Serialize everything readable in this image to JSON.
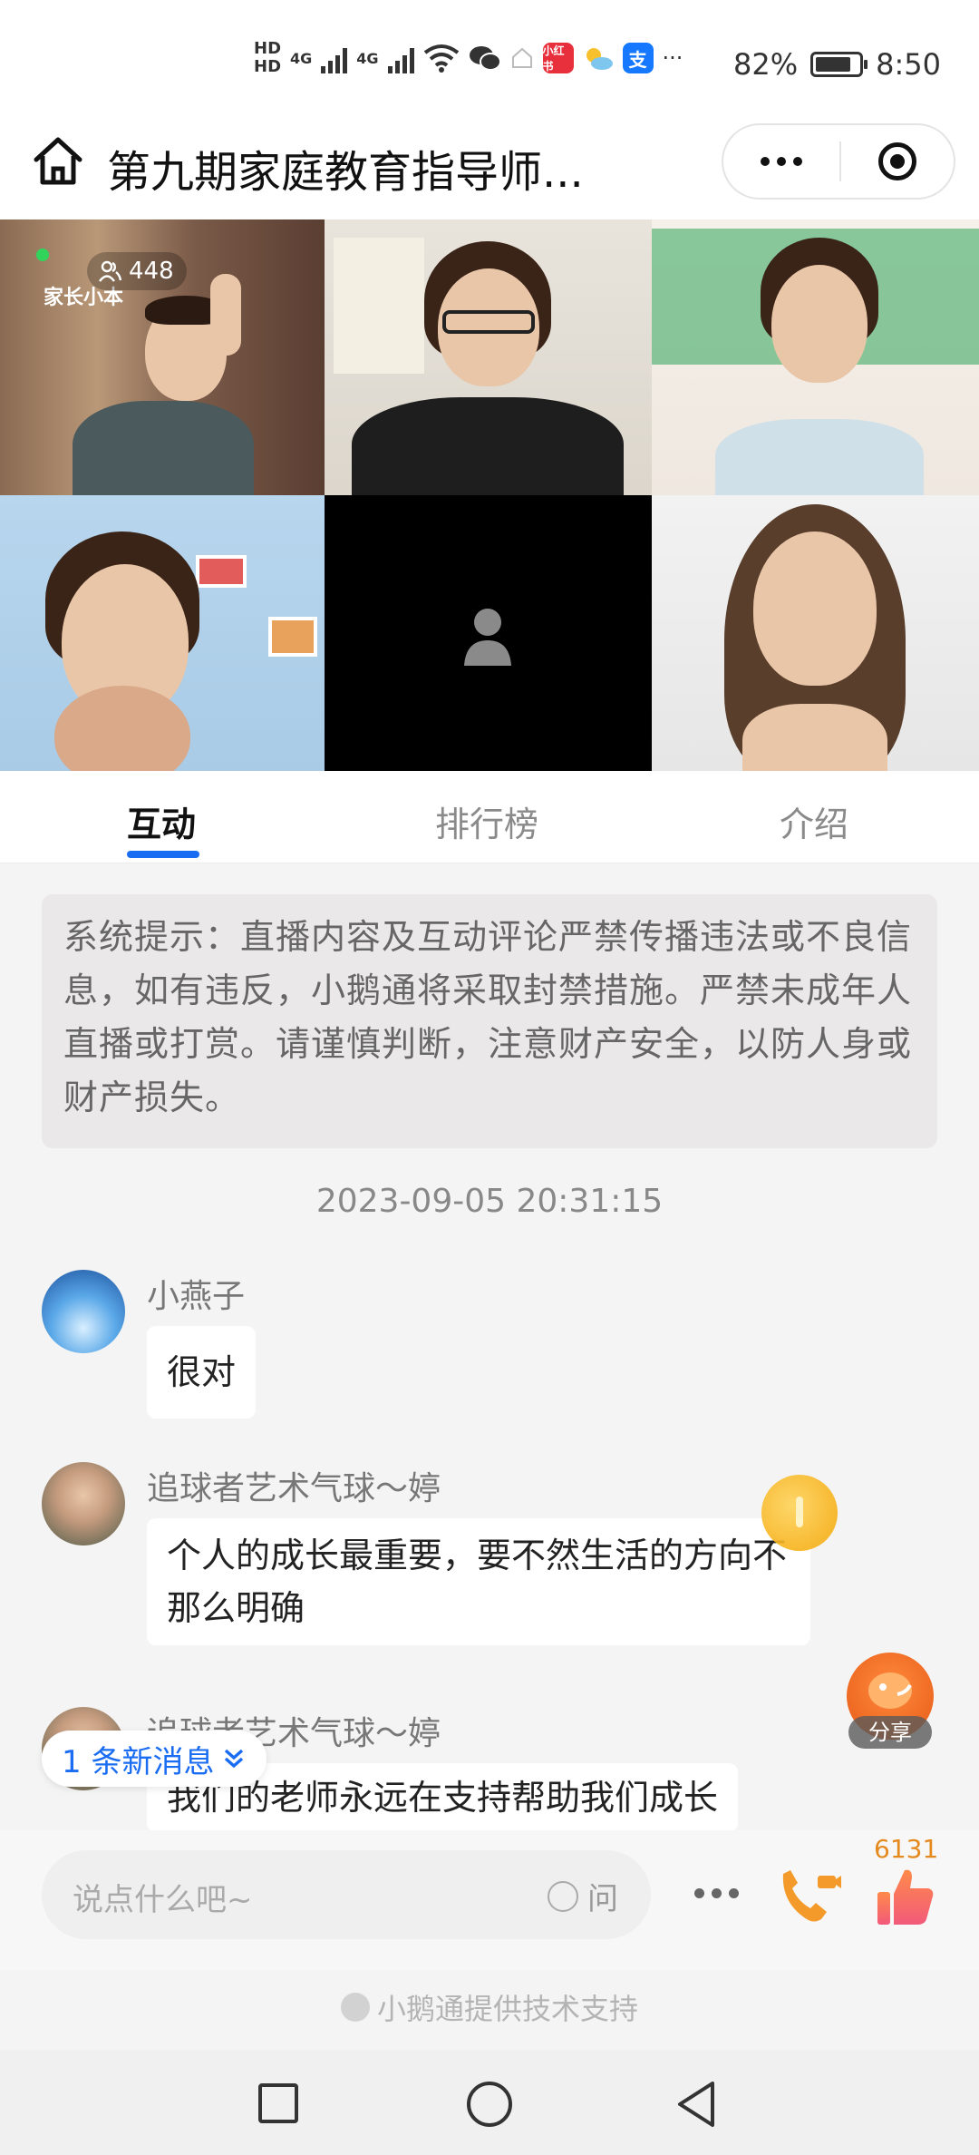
{
  "status_bar": {
    "hd1": "HD",
    "hd2": "HD",
    "net1": "4G",
    "net2": "4G",
    "app_red_label": "小红书",
    "app_blue_label": "支",
    "more": "···",
    "battery_percent": "82%",
    "battery_level": 0.82,
    "time": "8:50"
  },
  "navbar": {
    "title": "第九期家庭教育指导师..."
  },
  "video": {
    "viewer_count": "448",
    "brand": "家长小本"
  },
  "tabs": [
    {
      "label": "互动",
      "active": true
    },
    {
      "label": "排行榜",
      "active": false
    },
    {
      "label": "介绍",
      "active": false
    }
  ],
  "notice": {
    "text": "系统提示：直播内容及互动评论严禁传播违法或不良信息，如有违反，小鹅通将采取封禁措施。严禁未成年人直播或打赏。请谨慎判断，注意财产安全，以防人身或财产损失。"
  },
  "timestamp": "2023-09-05 20:31:15",
  "messages": [
    {
      "nickname": "小燕子",
      "text": "很对"
    },
    {
      "nickname": "追球者艺术气球～婷",
      "text": "个人的成长最重要，要不然生活的方向不那么明确"
    },
    {
      "nickname": "追球者艺术气球～婷",
      "text": "我们的老师永远在支持帮助我们成长"
    }
  ],
  "share_label": "分享",
  "new_message": "1 条新消息",
  "input": {
    "placeholder": "说点什么吧~",
    "ask_label": "问"
  },
  "like_count": "6131",
  "footer": "小鹅通提供技术支持",
  "colors": {
    "accent": "#1a6cf2",
    "like_orange": "#e58a1f",
    "live_dot": "#31d35a"
  }
}
